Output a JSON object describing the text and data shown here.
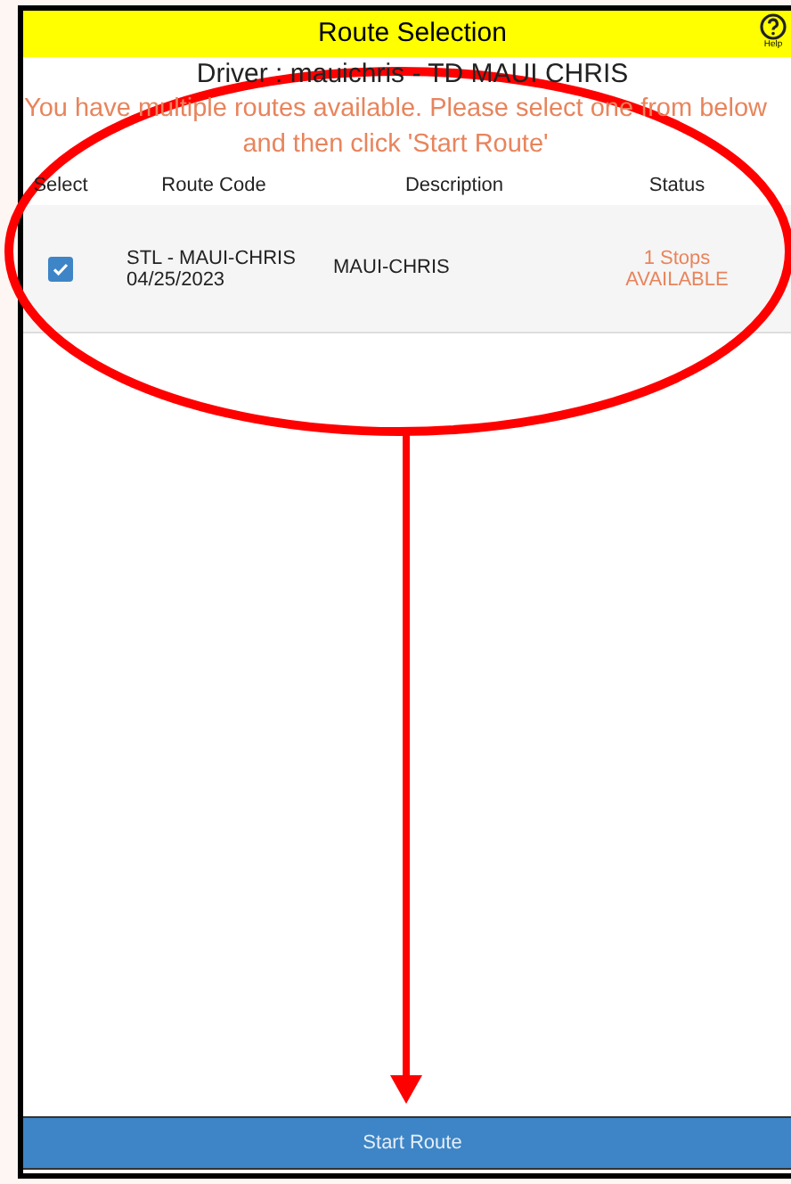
{
  "header": {
    "title": "Route Selection",
    "help_label": "Help"
  },
  "driver": "Driver : mauichris - TD MAUI CHRIS",
  "instruction": [
    "You have multiple routes available. Please select one from below",
    "and then click 'Start Route'"
  ],
  "table": {
    "columns": [
      "Select",
      "Route Code",
      "Description",
      "Status"
    ],
    "rows": [
      {
        "selected": true,
        "route_code": [
          "STL - MAUI-CHRIS",
          "04/25/2023"
        ],
        "description": "MAUI-CHRIS",
        "status": [
          "1 Stops",
          "AVAILABLE"
        ]
      }
    ]
  },
  "button": "Start Route"
}
